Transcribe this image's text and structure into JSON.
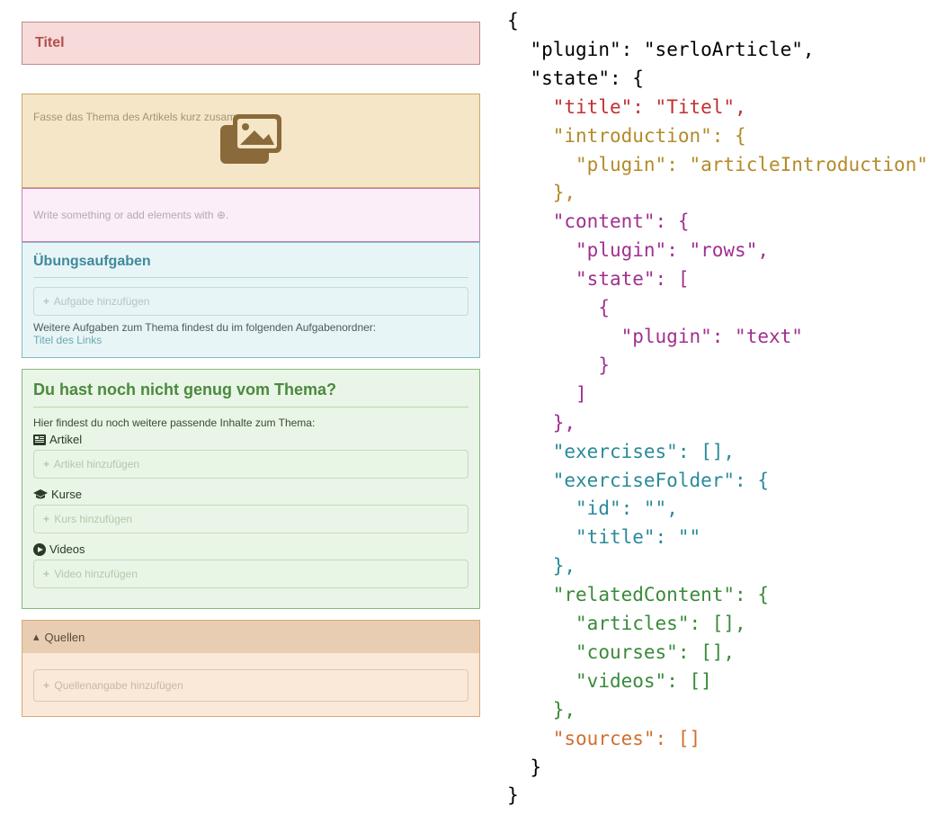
{
  "title": {
    "value": "Titel"
  },
  "intro": {
    "placeholder": "Fasse das Thema des Artikels kurz zusammen"
  },
  "content": {
    "placeholder": "Write something or add elements with ⊕."
  },
  "exercises": {
    "heading": "Übungsaufgaben",
    "add_label": "Aufgabe hinzufügen",
    "folder_note": "Weitere Aufgaben zum Thema findest du im folgenden Aufgabenordner:",
    "link_title_placeholder": "Titel des Links"
  },
  "related": {
    "heading": "Du hast noch nicht genug vom Thema?",
    "note": "Hier findest du noch weitere passende Inhalte zum Thema:",
    "articles_label": "Artikel",
    "articles_add": "Artikel hinzufügen",
    "courses_label": "Kurse",
    "courses_add": "Kurs hinzufügen",
    "videos_label": "Videos",
    "videos_add": "Video hinzufügen"
  },
  "sources": {
    "heading": "Quellen",
    "add_label": "Quellenangabe hinzufügen"
  },
  "json": {
    "l00": "{",
    "l01_a": "  \"plugin\"",
    "l01_b": ": ",
    "l01_c": "\"serloArticle\"",
    "l01_d": ",",
    "l02_a": "  \"state\"",
    "l02_b": ": {",
    "l03_a": "    \"title\"",
    "l03_b": ": ",
    "l03_c": "\"Titel\"",
    "l03_d": ",",
    "l04_a": "    \"introduction\"",
    "l04_b": ": {",
    "l05_a": "      \"plugin\"",
    "l05_b": ": ",
    "l05_c": "\"articleIntroduction\"",
    "l06": "    },",
    "l07_a": "    \"content\"",
    "l07_b": ": {",
    "l08_a": "      \"plugin\"",
    "l08_b": ": ",
    "l08_c": "\"rows\"",
    "l08_d": ",",
    "l09_a": "      \"state\"",
    "l09_b": ": [",
    "l10": "        {",
    "l11_a": "          \"plugin\"",
    "l11_b": ": ",
    "l11_c": "\"text\"",
    "l12": "        }",
    "l13": "      ]",
    "l14": "    },",
    "l15_a": "    \"exercises\"",
    "l15_b": ": [],",
    "l16_a": "    \"exerciseFolder\"",
    "l16_b": ": {",
    "l17_a": "      \"id\"",
    "l17_b": ": ",
    "l17_c": "\"\"",
    "l17_d": ",",
    "l18_a": "      \"title\"",
    "l18_b": ": ",
    "l18_c": "\"\"",
    "l19": "    },",
    "l20_a": "    \"relatedContent\"",
    "l20_b": ": {",
    "l21_a": "      \"articles\"",
    "l21_b": ": [],",
    "l22_a": "      \"courses\"",
    "l22_b": ": [],",
    "l23_a": "      \"videos\"",
    "l23_b": ": []",
    "l24": "    },",
    "l25_a": "    \"sources\"",
    "l25_b": ": []",
    "l26": "  }",
    "l27": "}"
  }
}
